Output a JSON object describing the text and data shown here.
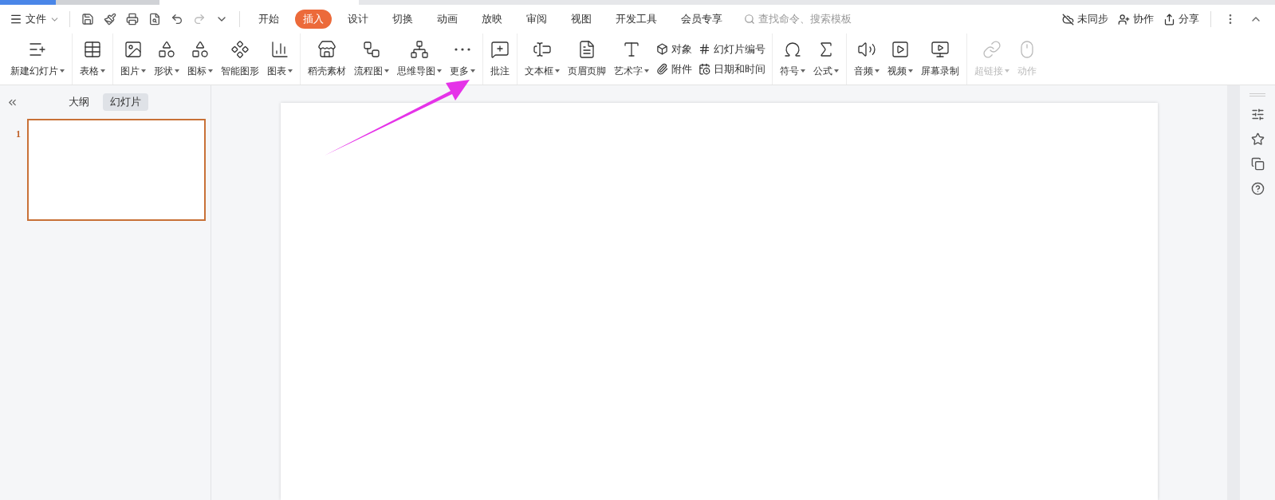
{
  "menu_bar": {
    "file_menu": {
      "label": "文件"
    },
    "tabs": [
      {
        "label": "开始",
        "selected": false
      },
      {
        "label": "插入",
        "selected": true
      },
      {
        "label": "设计",
        "selected": false
      },
      {
        "label": "切换",
        "selected": false
      },
      {
        "label": "动画",
        "selected": false
      },
      {
        "label": "放映",
        "selected": false
      },
      {
        "label": "审阅",
        "selected": false
      },
      {
        "label": "视图",
        "selected": false
      },
      {
        "label": "开发工具",
        "selected": false
      },
      {
        "label": "会员专享",
        "selected": false
      }
    ],
    "search": {
      "placeholder": "查找命令、搜索模板"
    },
    "actions": [
      {
        "label": "未同步"
      },
      {
        "label": "协作"
      },
      {
        "label": "分享"
      }
    ]
  },
  "ribbon": {
    "groups": [
      [
        {
          "kind": "big",
          "label": "新建幻灯片",
          "caret": true,
          "disabled": false
        }
      ],
      [
        {
          "kind": "big",
          "label": "表格",
          "caret": true,
          "disabled": false
        }
      ],
      [
        {
          "kind": "big",
          "label": "图片",
          "caret": true,
          "disabled": false
        },
        {
          "kind": "big",
          "label": "形状",
          "caret": true,
          "disabled": false
        },
        {
          "kind": "big",
          "label": "图标",
          "caret": true,
          "disabled": false
        },
        {
          "kind": "big",
          "label": "智能图形",
          "caret": false,
          "disabled": false
        },
        {
          "kind": "big",
          "label": "图表",
          "caret": true,
          "disabled": false
        }
      ],
      [
        {
          "kind": "big",
          "label": "稻壳素材",
          "caret": false,
          "disabled": false
        },
        {
          "kind": "big",
          "label": "流程图",
          "caret": true,
          "disabled": false
        },
        {
          "kind": "big",
          "label": "思维导图",
          "caret": true,
          "disabled": false
        },
        {
          "kind": "big",
          "label": "更多",
          "caret": true,
          "disabled": false
        }
      ],
      [
        {
          "kind": "big",
          "label": "批注",
          "caret": false,
          "disabled": false
        }
      ],
      [
        {
          "kind": "big",
          "label": "文本框",
          "caret": true,
          "disabled": false
        },
        {
          "kind": "big",
          "label": "页眉页脚",
          "caret": false,
          "disabled": false
        },
        {
          "kind": "big",
          "label": "艺术字",
          "caret": true,
          "disabled": false
        },
        {
          "kind": "stack",
          "items": [
            {
              "label": "对象"
            },
            {
              "label": "附件"
            }
          ]
        },
        {
          "kind": "stack",
          "items": [
            {
              "label": "幻灯片编号"
            },
            {
              "label": "日期和时间"
            }
          ]
        }
      ],
      [
        {
          "kind": "big",
          "label": "符号",
          "caret": true,
          "disabled": false
        },
        {
          "kind": "big",
          "label": "公式",
          "caret": true,
          "disabled": false
        }
      ],
      [
        {
          "kind": "big",
          "label": "音频",
          "caret": true,
          "disabled": false
        },
        {
          "kind": "big",
          "label": "视频",
          "caret": true,
          "disabled": false
        },
        {
          "kind": "big",
          "label": "屏幕录制",
          "caret": false,
          "disabled": false
        }
      ],
      [
        {
          "kind": "big",
          "label": "超链接",
          "caret": true,
          "disabled": true
        },
        {
          "kind": "big",
          "label": "动作",
          "caret": false,
          "disabled": true
        }
      ]
    ]
  },
  "slide_panel": {
    "tabs": [
      {
        "label": "大纲",
        "selected": false
      },
      {
        "label": "幻灯片",
        "selected": true
      }
    ],
    "slides": [
      {
        "number": "1",
        "selected": true
      }
    ]
  }
}
